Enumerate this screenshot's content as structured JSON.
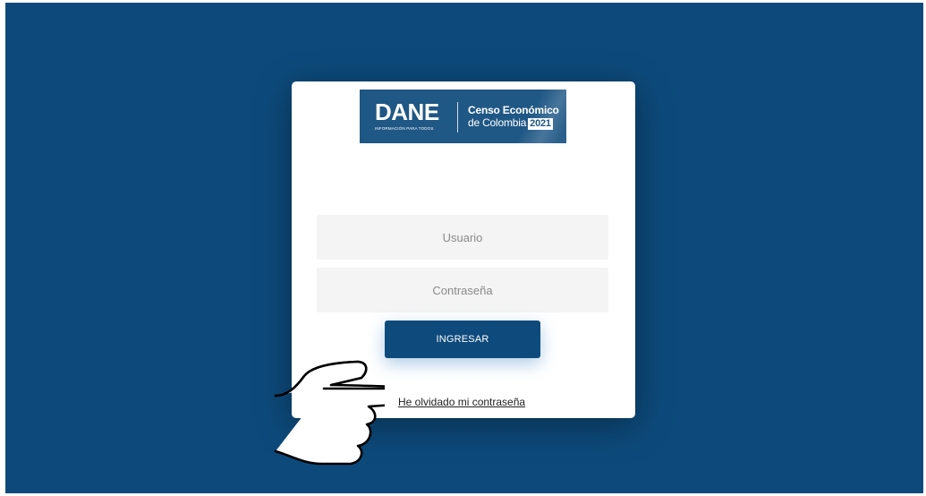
{
  "logo": {
    "brand": "DANE",
    "tagline": "INFORMACIÓN PARA TODOS",
    "line1": "Censo Económico",
    "line2": "de Colombia",
    "year": "2021"
  },
  "form": {
    "username_placeholder": "Usuario",
    "password_placeholder": "Contraseña",
    "submit_label": "INGRESAR",
    "forgot_link": "He olvidado mi contraseña"
  },
  "colors": {
    "background": "#0d4a7b",
    "button": "#0e4a7c",
    "field": "#f4f4f4"
  },
  "icons": [
    "pointing-hand-icon"
  ]
}
